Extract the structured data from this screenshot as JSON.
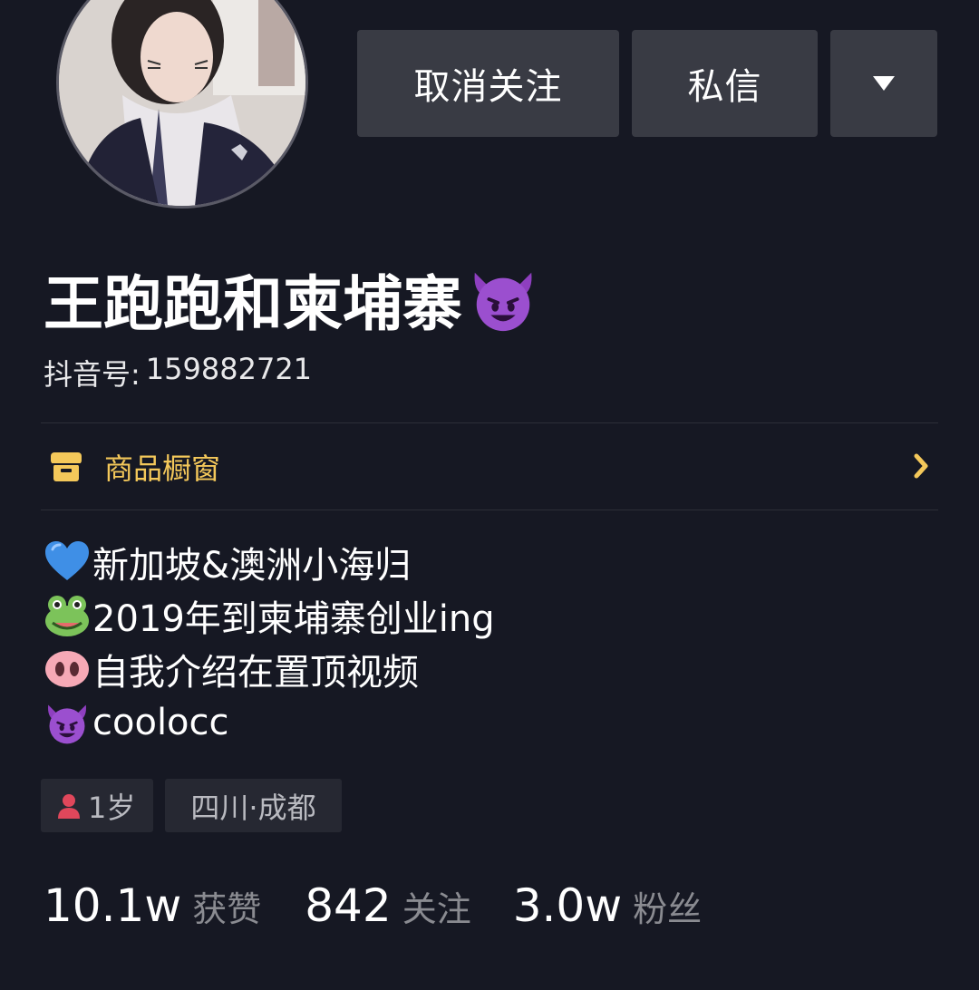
{
  "profile": {
    "avatar_alt": "user avatar",
    "name": "王跑跑和柬埔寨",
    "name_emoji": "smiling-devil-emoji",
    "douyin_id_label": "抖音号:",
    "douyin_id": "159882721"
  },
  "actions": {
    "unfollow_label": "取消关注",
    "message_label": "私信",
    "more_icon": "caret-down-icon"
  },
  "shop": {
    "icon": "shop-window-icon",
    "label": "商品橱窗",
    "chevron": "chevron-right-icon"
  },
  "bio": [
    {
      "emoji": "blue-heart-emoji",
      "text": "新加坡&澳洲小海归"
    },
    {
      "emoji": "frog-emoji",
      "text": "2019年到柬埔寨创业ing"
    },
    {
      "emoji": "pig-nose-emoji",
      "text": "自我介绍在置顶视频"
    },
    {
      "emoji": "smiling-devil-emoji",
      "text": "coolocc"
    }
  ],
  "tags": {
    "age_icon": "person-icon",
    "age": "1岁",
    "location": "四川·成都"
  },
  "stats": [
    {
      "value": "10.1w",
      "label": "获赞"
    },
    {
      "value": "842",
      "label": "关注"
    },
    {
      "value": "3.0w",
      "label": "粉丝"
    }
  ],
  "colors": {
    "background": "#161823",
    "button": "#393b44",
    "shop_accent": "#f4c85a",
    "muted_text": "#8a8b91",
    "tag_bg": "#262832"
  }
}
